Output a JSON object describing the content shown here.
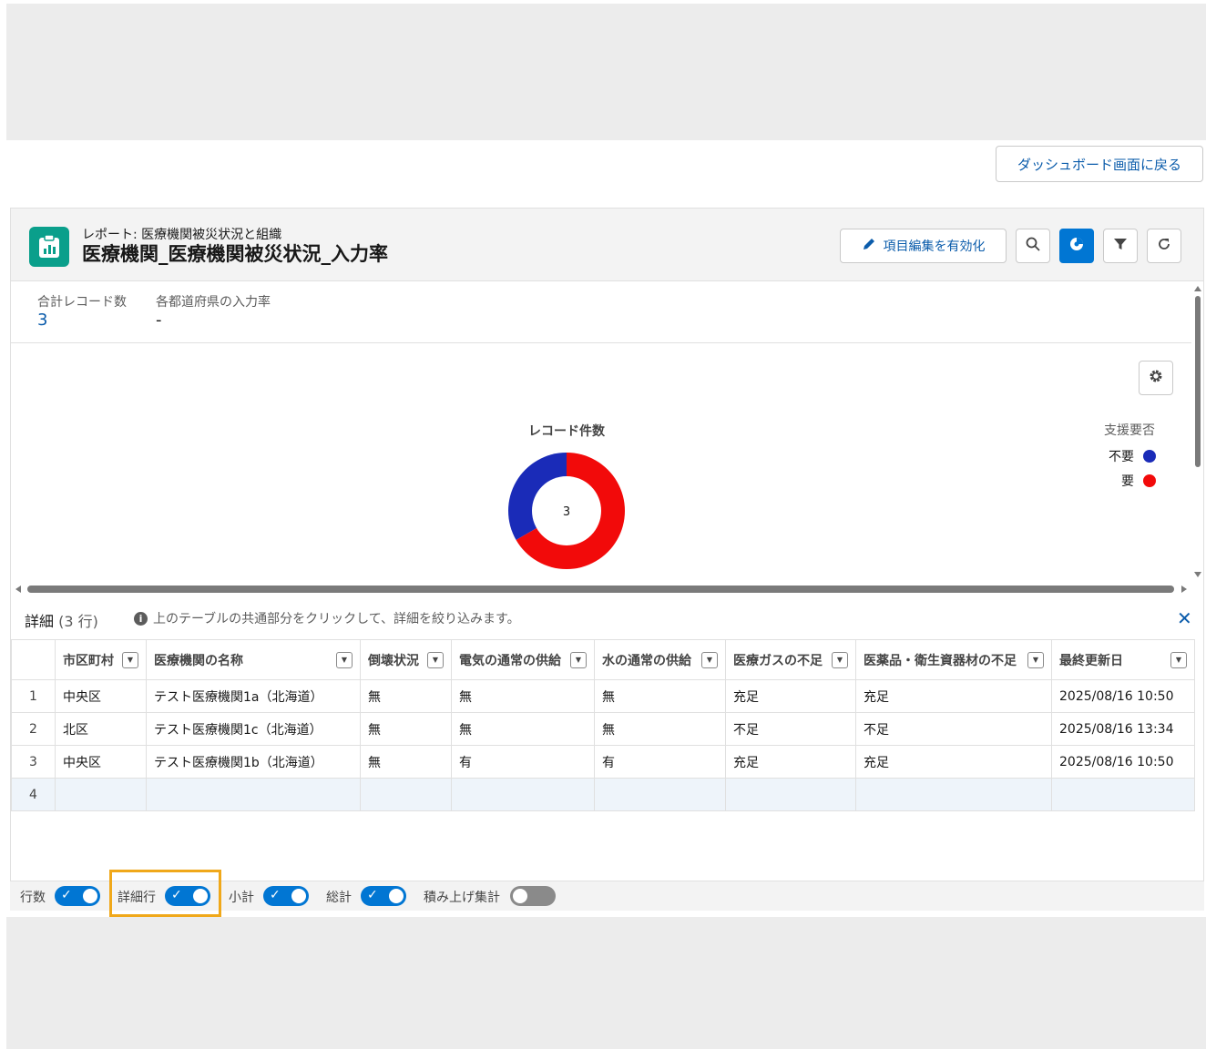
{
  "back_button": {
    "label": "ダッシュボード画面に戻る"
  },
  "report": {
    "kicker": "レポート: 医療機関被災状況と組織",
    "title": "医療機関_医療機関被災状況_入力率",
    "edit_button_label": "項目編集を有効化"
  },
  "summary": {
    "items": [
      {
        "label": "合計レコード数",
        "value": "3"
      },
      {
        "label": "各都道府県の入力率",
        "value": "-"
      }
    ]
  },
  "chart_data": {
    "type": "pie",
    "title": "レコード件数",
    "center_label": "3",
    "legend_title": "支援要否",
    "legend_position": "right",
    "slices": [
      {
        "name": "不要",
        "value": 1,
        "color": "#1a2bb8"
      },
      {
        "name": "要",
        "value": 2,
        "color": "#f20a0a"
      }
    ]
  },
  "detail": {
    "title": "詳細",
    "count": "(3 行)",
    "info": "上のテーブルの共通部分をクリックして、詳細を絞り込みます。"
  },
  "table": {
    "columns": [
      "市区町村",
      "医療機関の名称",
      "倒壊状況",
      "電気の通常の供給",
      "水の通常の供給",
      "医療ガスの不足",
      "医薬品・衛生資器材の不足",
      "最終更新日"
    ],
    "rows": [
      [
        "1",
        "中央区",
        "テスト医療機関1a（北海道）",
        "無",
        "無",
        "無",
        "充足",
        "充足",
        "2025/08/16 10:50"
      ],
      [
        "2",
        "北区",
        "テスト医療機関1c（北海道）",
        "無",
        "無",
        "無",
        "不足",
        "不足",
        "2025/08/16 13:34"
      ],
      [
        "3",
        "中央区",
        "テスト医療機関1b（北海道）",
        "無",
        "有",
        "有",
        "充足",
        "充足",
        "2025/08/16 10:50"
      ],
      [
        "4",
        "",
        "",
        "",
        "",
        "",
        "",
        "",
        ""
      ]
    ]
  },
  "footer": {
    "toggles": [
      {
        "label": "行数",
        "on": true
      },
      {
        "label": "詳細行",
        "on": true
      },
      {
        "label": "小計",
        "on": true
      },
      {
        "label": "総計",
        "on": true
      },
      {
        "label": "積み上げ集計",
        "on": false
      }
    ]
  },
  "colors": {
    "brand_blue": "#0176d3",
    "link_blue": "#0b5cab",
    "report_icon": "#0a9f8b",
    "highlight": "#f0a81a"
  }
}
